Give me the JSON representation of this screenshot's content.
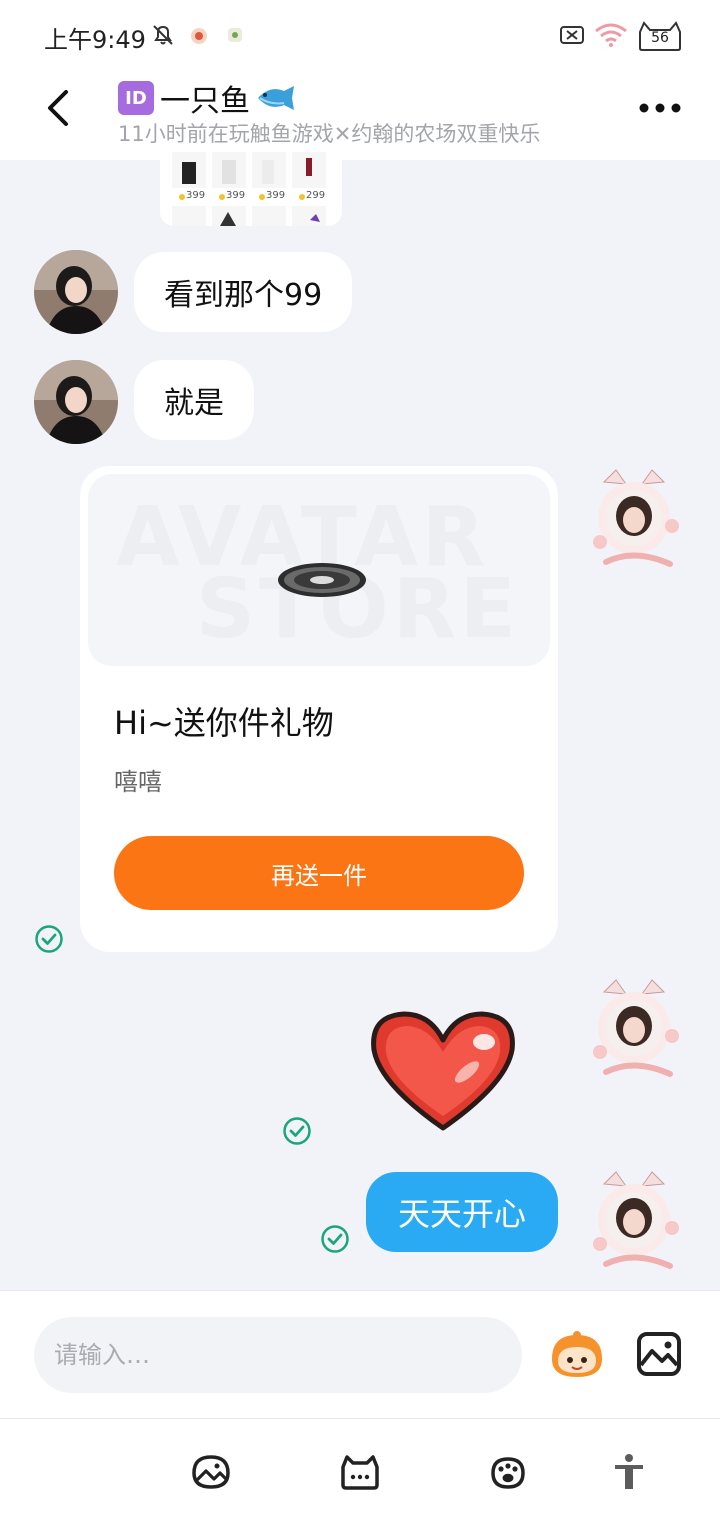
{
  "status_bar": {
    "time": "上午9:49",
    "battery": "56",
    "icons": [
      "mute-bell-icon",
      "app-notification-icon",
      "app-notification-icon",
      "no-sim-icon",
      "wifi-icon",
      "battery-icon"
    ]
  },
  "header": {
    "badge": "ID",
    "title": "一只鱼",
    "subtitle": "11小时前在玩触鱼游戏✕约翰的农场双重快乐",
    "icons": [
      "back-arrow-icon",
      "fish-emoji-icon",
      "more-dots-icon"
    ]
  },
  "messages": [
    {
      "side": "left",
      "type": "text",
      "text": "看到那个99"
    },
    {
      "side": "left",
      "type": "text",
      "text": "就是"
    },
    {
      "side": "right",
      "type": "gift",
      "banner_text": [
        "AVATAR",
        "STORE"
      ],
      "title": "Hi~送你件礼物",
      "subtitle": "嘻嘻",
      "button": "再送一件"
    },
    {
      "side": "right",
      "type": "sticker",
      "sticker": "heart-sticker"
    },
    {
      "side": "right",
      "type": "text",
      "text": "天天开心"
    }
  ],
  "sticker_prices": [
    "399",
    "399",
    "399",
    "299"
  ],
  "composer": {
    "placeholder": "请输入…",
    "icons": [
      "emoji-mascot-icon",
      "image-icon"
    ]
  },
  "toolbar": {
    "icons": [
      "gallery-icon",
      "chat-cat-icon",
      "paw-icon",
      "accessibility-icon"
    ]
  },
  "colors": {
    "accent_orange": "#fb7514",
    "bubble_blue": "#2aaaf2",
    "check_green": "#1aa57a",
    "id_badge": "#a76be0"
  }
}
